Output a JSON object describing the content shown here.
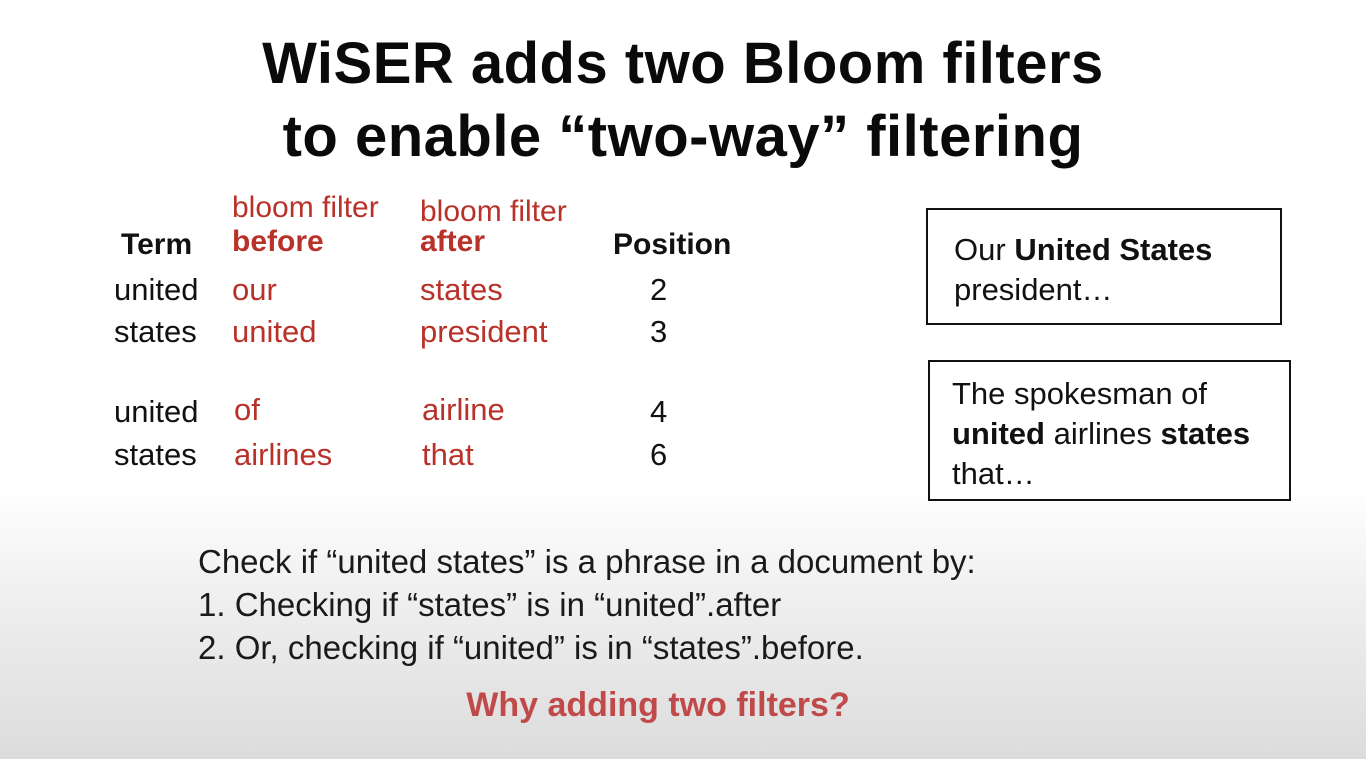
{
  "title": {
    "line1": "WiSER adds two Bloom filters",
    "line2": "to enable “two-way” filtering"
  },
  "table": {
    "headers": {
      "term": "Term",
      "before_top": "bloom filter",
      "before_bottom": "before",
      "after_top": "bloom filter",
      "after_bottom": "after",
      "position": "Position"
    },
    "rows": [
      {
        "term": "united",
        "before": "our",
        "after": "states",
        "position": "2"
      },
      {
        "term": "states",
        "before": "united",
        "after": "president",
        "position": "3"
      },
      {
        "term": "united",
        "before": "of",
        "after": "airline",
        "position": "4"
      },
      {
        "term": "states",
        "before": "airlines",
        "after": "that",
        "position": "6"
      }
    ]
  },
  "doc1": {
    "w1": "Our",
    "w2": "United States",
    "w3": "president…"
  },
  "doc2": {
    "w1": "The spokesman of",
    "w2": "united",
    "w3": "airlines",
    "w4": "states",
    "w5": "that…"
  },
  "bottom": {
    "intro": "Check if “united states” is a phrase in a document by:",
    "step1": "1.  Checking if “states” is in “united”.after",
    "step2": "2.  Or, checking if “united” is in “states”.before.",
    "question": "Why adding two filters?"
  }
}
